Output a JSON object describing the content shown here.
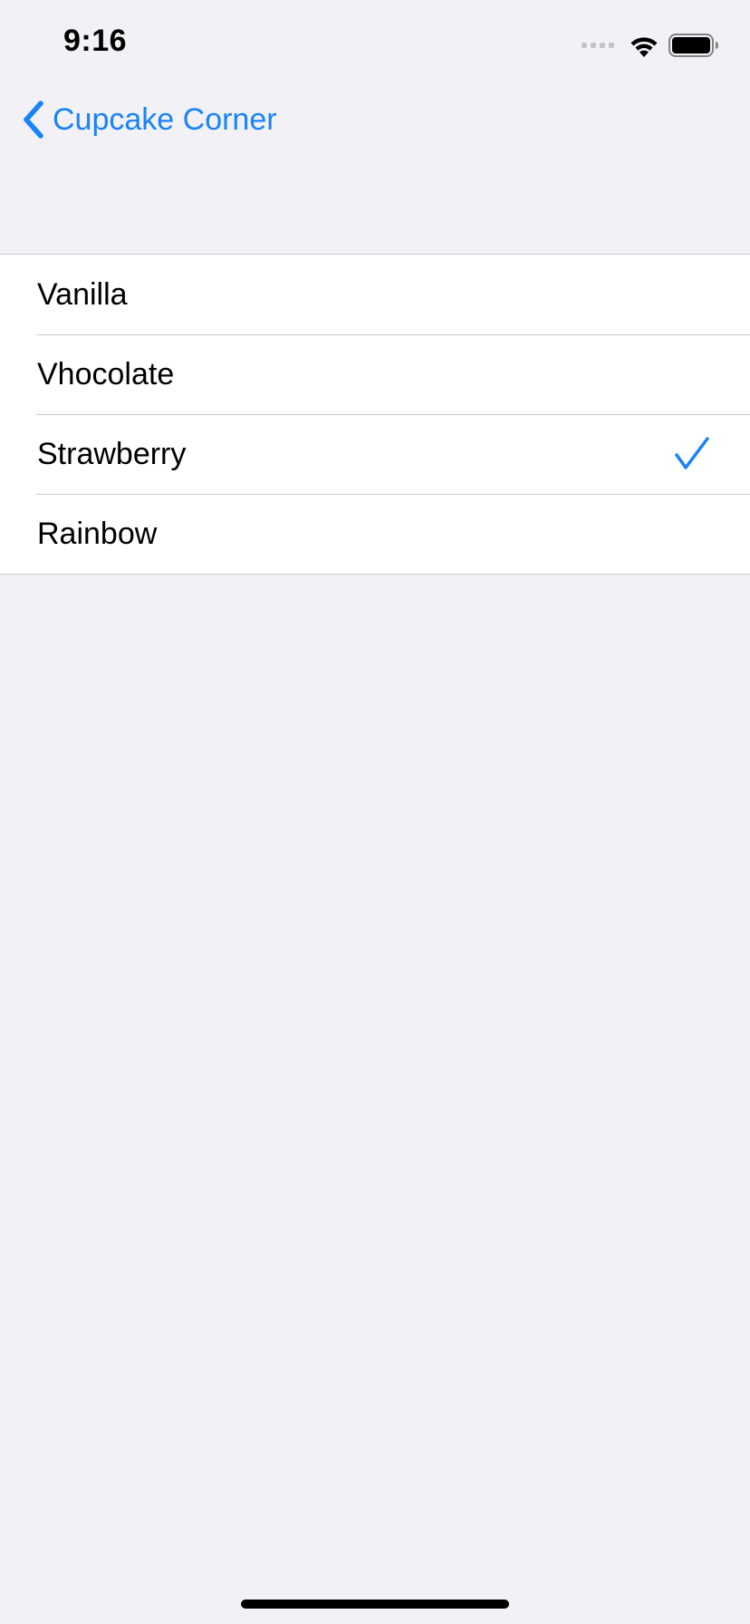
{
  "status_bar": {
    "time": "9:16",
    "icons": [
      "cellular-signal-icon",
      "wifi-icon",
      "battery-icon"
    ]
  },
  "nav": {
    "back_label": "Cupcake Corner",
    "back_icon": "chevron-left-icon"
  },
  "flavors": [
    {
      "label": "Vanilla",
      "selected": false
    },
    {
      "label": "Vhocolate",
      "selected": false
    },
    {
      "label": "Strawberry",
      "selected": true
    },
    {
      "label": "Rainbow",
      "selected": false
    }
  ],
  "colors": {
    "accent": "#1a82fb",
    "background": "#f1f1f6",
    "cell_background": "#ffffff",
    "separator": "#c8c8cc"
  }
}
